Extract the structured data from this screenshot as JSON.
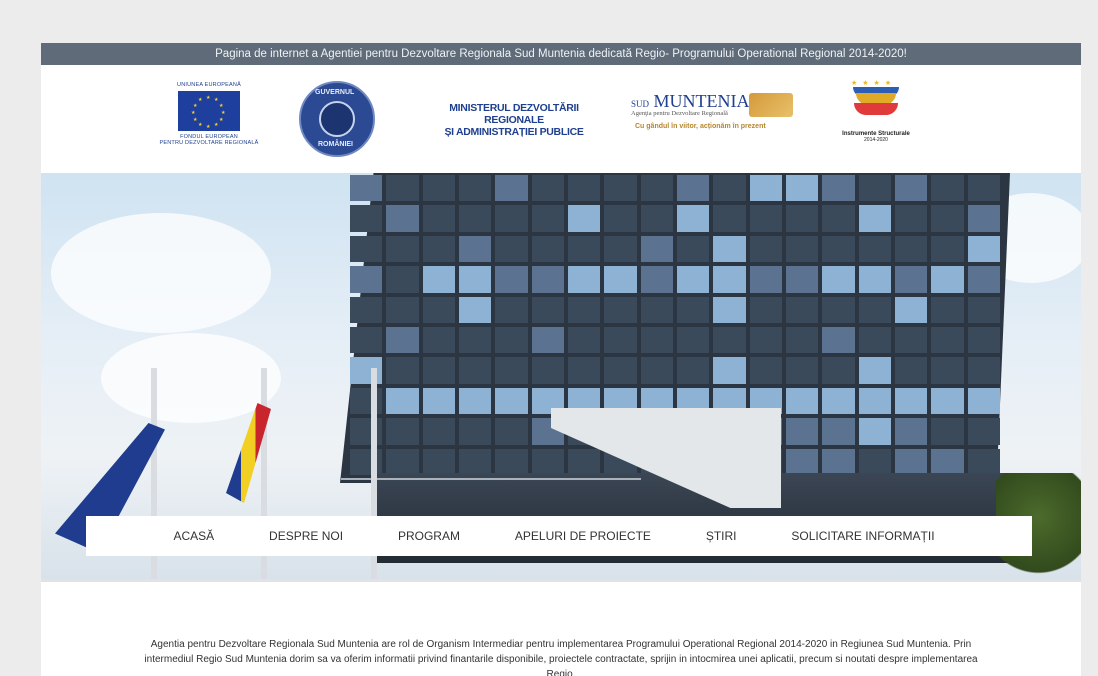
{
  "topbar": {
    "text": "Pagina de internet a Agentiei pentru Dezvoltare Regionala Sud Muntenia dedicată Regio- Programului Operational Regional 2014-2020!"
  },
  "logos": {
    "eu_top": "UNIUNEA EUROPEANĂ",
    "eu_bottom_1": "FONDUL EUROPEAN",
    "eu_bottom_2": "PENTRU DEZVOLTARE REGIONALĂ",
    "gov_top": "GUVERNUL",
    "gov_bottom": "ROMÂNIEI",
    "ministry_line1": "MINISTERUL DEZVOLTĂRII REGIONALE",
    "ministry_line2": "ȘI ADMINISTRAȚIEI PUBLICE",
    "sud_prefix": "SUD",
    "sud_title": "MUNTENIA",
    "sud_sub": "Agenţia pentru Dezvoltare Regională",
    "sud_slogan": "Cu gândul în viitor, acționăm în prezent",
    "inst_title": "Instrumente Structurale",
    "inst_years": "2014-2020"
  },
  "nav": {
    "items": [
      "ACASĂ",
      "DESPRE NOI",
      "PROGRAM",
      "APELURI DE PROIECTE",
      "ȘTIRI",
      "SOLICITARE INFORMAȚII"
    ]
  },
  "intro": {
    "text": "Agentia pentru Dezvoltare Regionala Sud Muntenia are rol de Organism Intermediar pentru implementarea Programului Operational Regional 2014-2020 in Regiunea Sud Muntenia. Prin intermediul Regio Sud Muntenia dorim sa va oferim informatii privind finantarile disponibile, proiectele contractate, sprijin in intocmirea unei aplicatii, precum si noutati despre implementarea Regio."
  },
  "colors": {
    "topbar": "#5f6b78",
    "brand_blue": "#1f3f8f",
    "gold": "#b7862c"
  }
}
